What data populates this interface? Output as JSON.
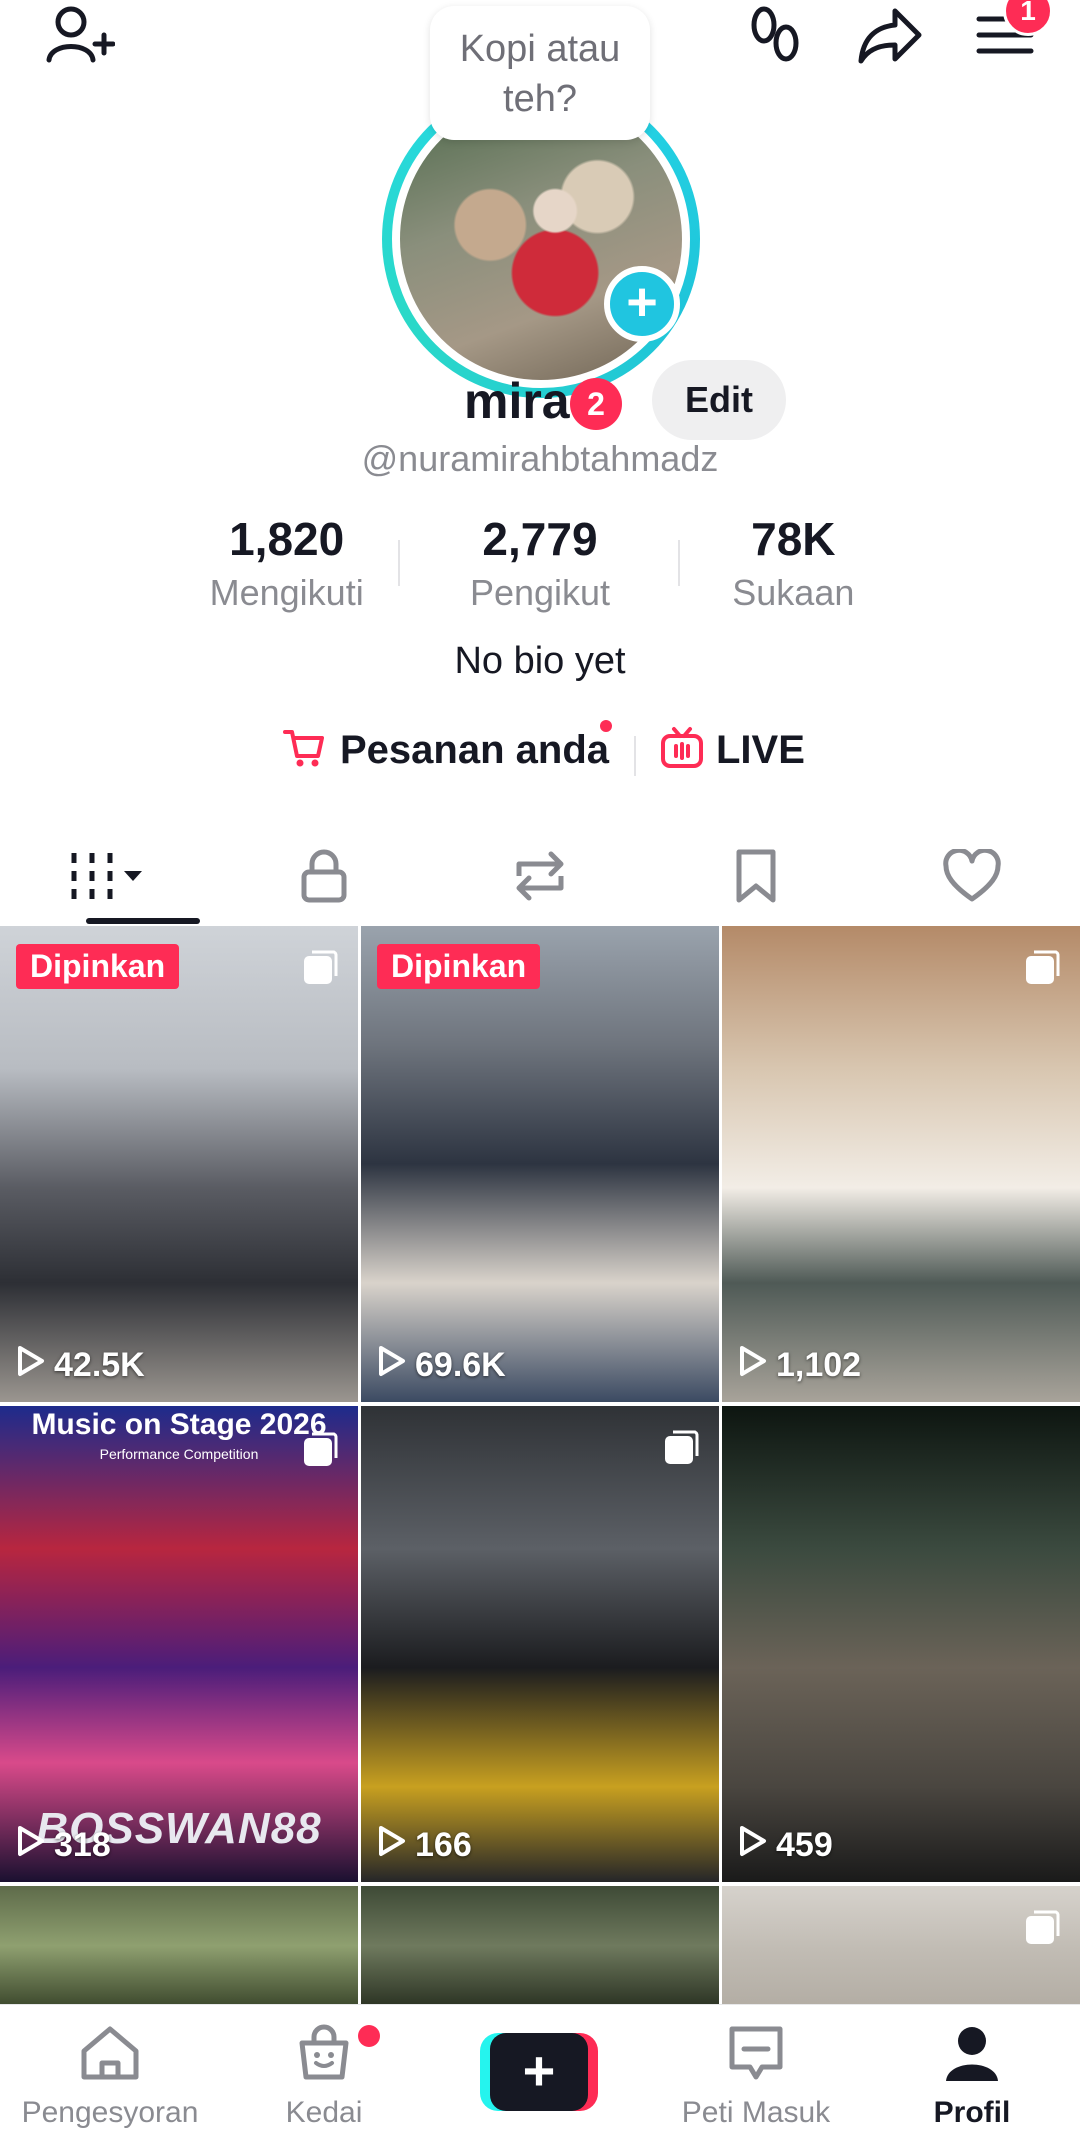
{
  "top_bar": {
    "menu_badge": "1"
  },
  "bubble": {
    "text": "Kopi atau teh?"
  },
  "profile": {
    "name": "mira",
    "name_badge": "2",
    "edit_label": "Edit",
    "handle": "@nuramirahbtahmadz",
    "bio": "No bio yet"
  },
  "stats": [
    {
      "value": "1,820",
      "label": "Mengikuti"
    },
    {
      "value": "2,779",
      "label": "Pengikut"
    },
    {
      "value": "78K",
      "label": "Sukaan"
    }
  ],
  "links": {
    "orders_label": "Pesanan anda",
    "live_label": "LIVE"
  },
  "tabs": [
    "videos",
    "private",
    "reposts",
    "favorites",
    "liked"
  ],
  "videos": [
    {
      "views": "42.5K",
      "pinned": "Dipinkan"
    },
    {
      "views": "69.6K",
      "pinned": "Dipinkan"
    },
    {
      "views": "1,102"
    },
    {
      "views": "318",
      "title": "Music on Stage 2026",
      "subtitle": "Performance Competition",
      "brand": "BOSSWAN88"
    },
    {
      "views": "166"
    },
    {
      "views": "459"
    }
  ],
  "bottom_nav": [
    {
      "label": "Pengesyoran",
      "icon": "home-icon"
    },
    {
      "label": "Kedai",
      "icon": "shop-icon"
    },
    {
      "label": "",
      "icon": "create-icon"
    },
    {
      "label": "Peti Masuk",
      "icon": "inbox-icon"
    },
    {
      "label": "Profil",
      "icon": "profile-icon"
    }
  ],
  "colors": {
    "accent": "#fe2c55",
    "ring": "#25d7e8",
    "text": "#161823",
    "muted": "#8a8b91"
  }
}
